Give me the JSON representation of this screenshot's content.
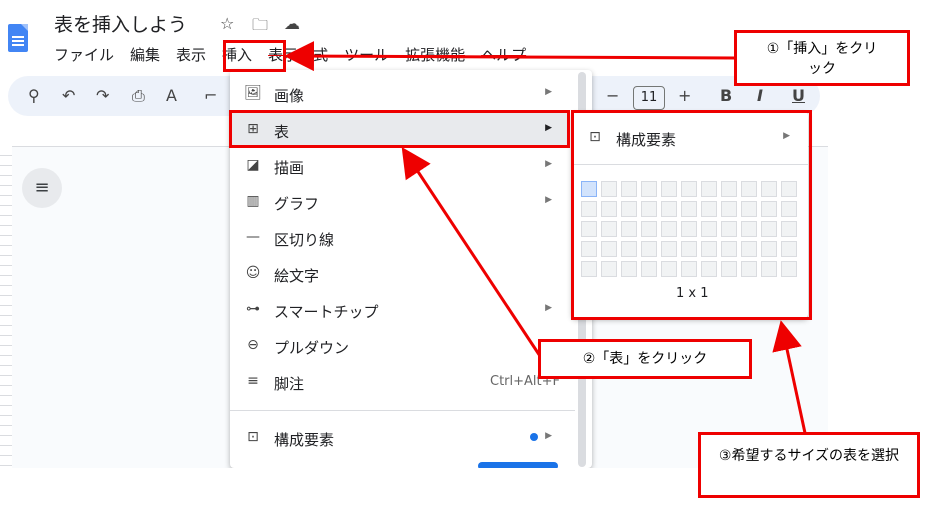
{
  "doc": {
    "title": "表を挿入しよう",
    "star_icon": "☆",
    "folder_icon": "🗀",
    "cloud_icon": "☁"
  },
  "menubar": [
    "ファイル",
    "編集",
    "表示",
    "挿入",
    "表示形式",
    "ツール",
    "拡張機能",
    "ヘルプ"
  ],
  "toolbar": {
    "font_size": "11",
    "minus": "−",
    "plus": "+",
    "bold": "B",
    "italic": "I",
    "underline": "U"
  },
  "insert_menu": {
    "items": [
      {
        "icon": "🖼",
        "label": "画像",
        "arrow": "▶"
      },
      {
        "icon": "⊞",
        "label": "表",
        "arrow": "▶"
      },
      {
        "icon": "◪",
        "label": "描画",
        "arrow": "▶"
      },
      {
        "icon": "▥",
        "label": "グラフ",
        "arrow": "▶"
      },
      {
        "icon": "—",
        "label": "区切り線"
      },
      {
        "icon": "☺",
        "label": "絵文字"
      },
      {
        "icon": "⊶",
        "label": "スマートチップ",
        "arrow": "▶"
      },
      {
        "icon": "⊖",
        "label": "プルダウン"
      },
      {
        "icon": "≡",
        "label": "脚注",
        "shortcut": "Ctrl+Alt+F"
      },
      {
        "icon": "⊡",
        "label": "構成要素",
        "arrow": "▶"
      }
    ]
  },
  "table_submenu": {
    "item_label": "構成要素",
    "item_icon": "⊡",
    "arrow": "▶",
    "size_label": "1 x 1",
    "rows": 5,
    "cols": 11,
    "selected_rows": 1,
    "selected_cols": 1
  },
  "annotations": {
    "step1": "①「挿入」をクリック",
    "step2": "②「表」をクリック",
    "step3": "③希望するサイズの表を選択"
  },
  "colors": {
    "annotation": "#e00000",
    "selected_cell": "#d2e3fc",
    "accent": "#1a73e8"
  }
}
